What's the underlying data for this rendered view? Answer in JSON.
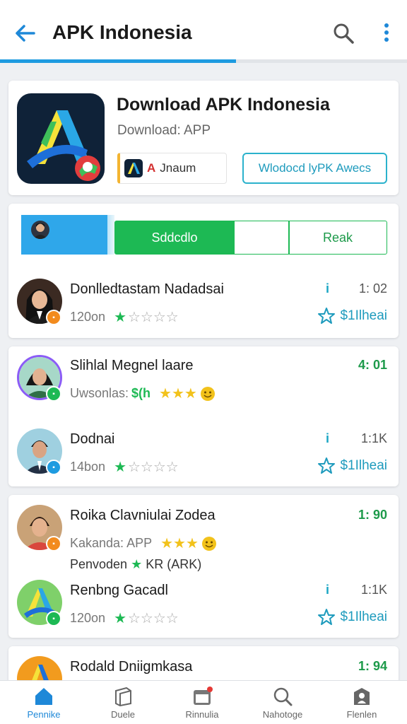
{
  "appbar": {
    "title": "APK Indonesia",
    "progress": 0.58
  },
  "hero": {
    "title": "Download APK Indonesia",
    "subtitle": "Download: APP",
    "badge_label": "Jnaum",
    "badge_prefix": "A",
    "outline_button": "Wlodocd lyPK Awecs"
  },
  "tabs": {
    "active": "Sddcdlo",
    "right": "Reak"
  },
  "rows": [
    {
      "name": "Donlledtastam Nadadsai",
      "sub": "120on",
      "rating_icons": "1/5",
      "count": "1: 02",
      "action": "$1Ilheai",
      "badge_color": "#f28b1e"
    },
    {
      "name": "Slihlal Megnel laare",
      "sub": "Uwsonlas:",
      "sub_extra": "$(h",
      "count": "4: 01",
      "badge_color": "#1db954"
    },
    {
      "name": "Dodnai",
      "sub": "14bon",
      "count": "1:1K",
      "action": "$1Ilheai",
      "badge_color": "#1e9be0"
    },
    {
      "name": "Roika Clavniulai Zodea",
      "sub": "Kakanda: APP",
      "sub2": "Penvoden",
      "sub2_tail": "KR (ARK)",
      "count": "1: 90",
      "badge_color": "#f28b1e"
    },
    {
      "name": "Renbng Gacadl",
      "sub": "120on",
      "count": "1:1K",
      "action": "$1Ilheai",
      "badge_color": "#1db954"
    },
    {
      "name": "Rodald Dniigmkasa",
      "count": "1: 94"
    }
  ],
  "nav": [
    {
      "label": "Pennike",
      "icon": "home-icon"
    },
    {
      "label": "Duele",
      "icon": "book-icon"
    },
    {
      "label": "Rinnulia",
      "icon": "calendar-icon"
    },
    {
      "label": "Nahotoge",
      "icon": "search-icon"
    },
    {
      "label": "Flenlen",
      "icon": "profile-icon"
    }
  ],
  "colors": {
    "accent": "#1e9be0",
    "green": "#1db954",
    "star": "#f2c21b"
  }
}
